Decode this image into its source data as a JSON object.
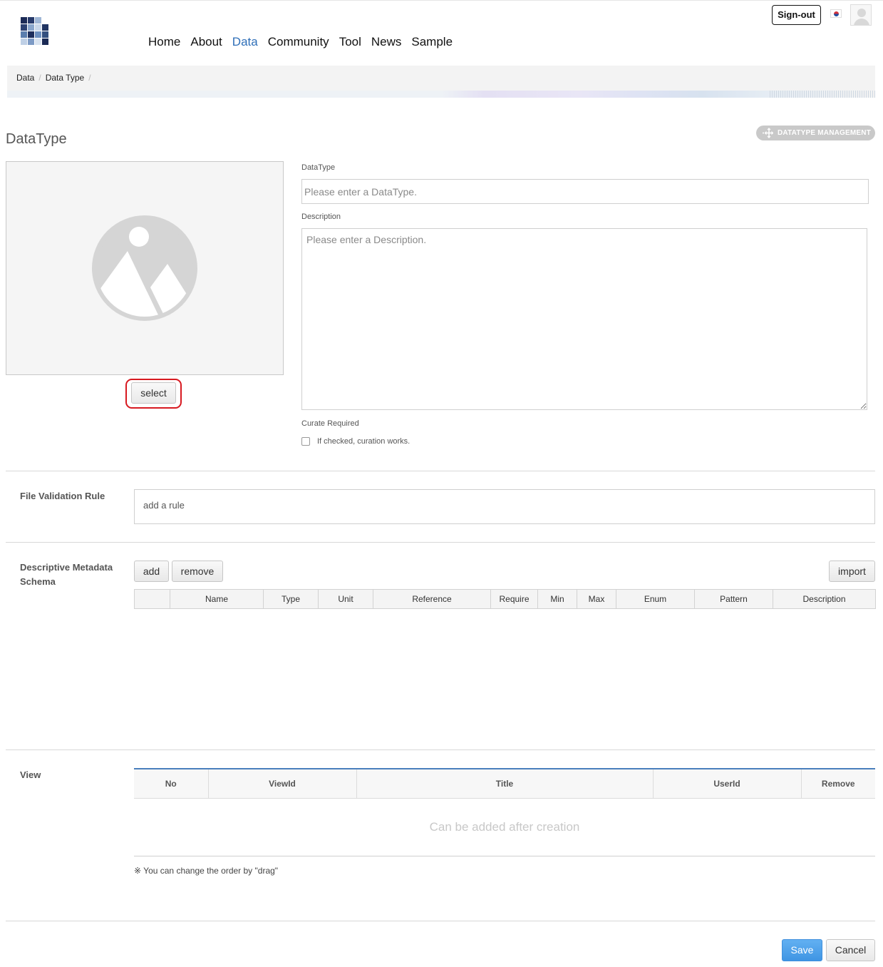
{
  "header": {
    "nav": [
      "Home",
      "About",
      "Data",
      "Community",
      "Tool",
      "News",
      "Sample"
    ],
    "active_nav": "Data",
    "signout_label": "Sign-out",
    "language_icon": "korea-flag-icon",
    "avatar_icon": "user-avatar-icon"
  },
  "breadcrumb": [
    "Data",
    "Data Type"
  ],
  "page": {
    "title": "DataType",
    "management_button": "DATATYPE MANAGEMENT"
  },
  "image_panel": {
    "placeholder_icon": "image-placeholder-icon",
    "select_label": "select"
  },
  "form": {
    "datatype_label": "DataType",
    "datatype_placeholder": "Please enter a DataType.",
    "datatype_value": "",
    "description_label": "Description",
    "description_placeholder": "Please enter a Description.",
    "description_value": "",
    "curate_label": "Curate Required",
    "curate_checkbox_text": "If checked, curation works.",
    "curate_checked": false
  },
  "file_validation": {
    "label": "File Validation Rule",
    "placeholder": "add a rule"
  },
  "metadata": {
    "label": "Descriptive Metadata Schema",
    "add_label": "add",
    "remove_label": "remove",
    "import_label": "import",
    "columns": [
      "",
      "Name",
      "Type",
      "Unit",
      "Reference",
      "Require",
      "Min",
      "Max",
      "Enum",
      "Pattern",
      "Description"
    ]
  },
  "view": {
    "label": "View",
    "columns": [
      "No",
      "ViewId",
      "Title",
      "UserId",
      "Remove"
    ],
    "empty_message": "Can be added after creation",
    "drag_note": "※ You can change the order by \"drag\""
  },
  "footer": {
    "save_label": "Save",
    "cancel_label": "Cancel"
  },
  "colors": {
    "accent": "#2f6fb8",
    "save": "#4a9fe8",
    "highlight_ring": "#d71920"
  }
}
